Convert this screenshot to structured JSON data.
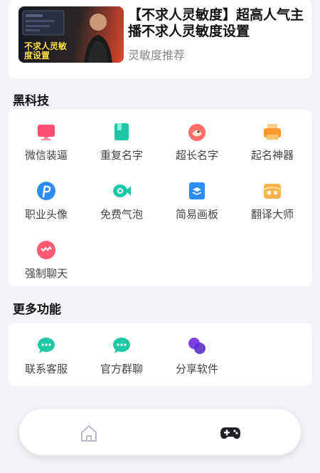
{
  "featured": {
    "title": "【不求人灵敏度】超高人气主播不求人灵敏度设置",
    "subtitle": "灵敏度推荐",
    "thumbnail_text": "不求人灵敏度设置"
  },
  "sections": {
    "black_tech": {
      "title": "黑科技",
      "items": [
        {
          "label": "微信装逼",
          "icon": "monitor-icon",
          "color": "#ff4d6d"
        },
        {
          "label": "重复名字",
          "icon": "book-icon",
          "color": "#1ec7a5"
        },
        {
          "label": "超长名字",
          "icon": "chick-icon",
          "color": "#ff6b6b"
        },
        {
          "label": "起名神器",
          "icon": "printer-icon",
          "color": "#ff9a2e"
        },
        {
          "label": "职业头像",
          "icon": "p-icon",
          "color": "#2d8cf0"
        },
        {
          "label": "免费气泡",
          "icon": "fish-icon",
          "color": "#1ec7a5"
        },
        {
          "label": "简易画板",
          "icon": "layers-icon",
          "color": "#2d8cf0"
        },
        {
          "label": "翻译大师",
          "icon": "translate-icon",
          "color": "#ffb34d"
        },
        {
          "label": "强制聊天",
          "icon": "chat-icon",
          "color": "#ff5a72"
        }
      ]
    },
    "more": {
      "title": "更多功能",
      "items": [
        {
          "label": "联系客服",
          "icon": "message-icon",
          "color": "#22c7a3"
        },
        {
          "label": "官方群聊",
          "icon": "group-message-icon",
          "color": "#22c7a3"
        },
        {
          "label": "分享软件",
          "icon": "share-icon",
          "color": "#7b3fe4"
        }
      ]
    }
  },
  "navbar": {
    "items": [
      {
        "icon": "home-icon",
        "active": false
      },
      {
        "icon": "gamepad-icon",
        "active": true
      }
    ]
  }
}
